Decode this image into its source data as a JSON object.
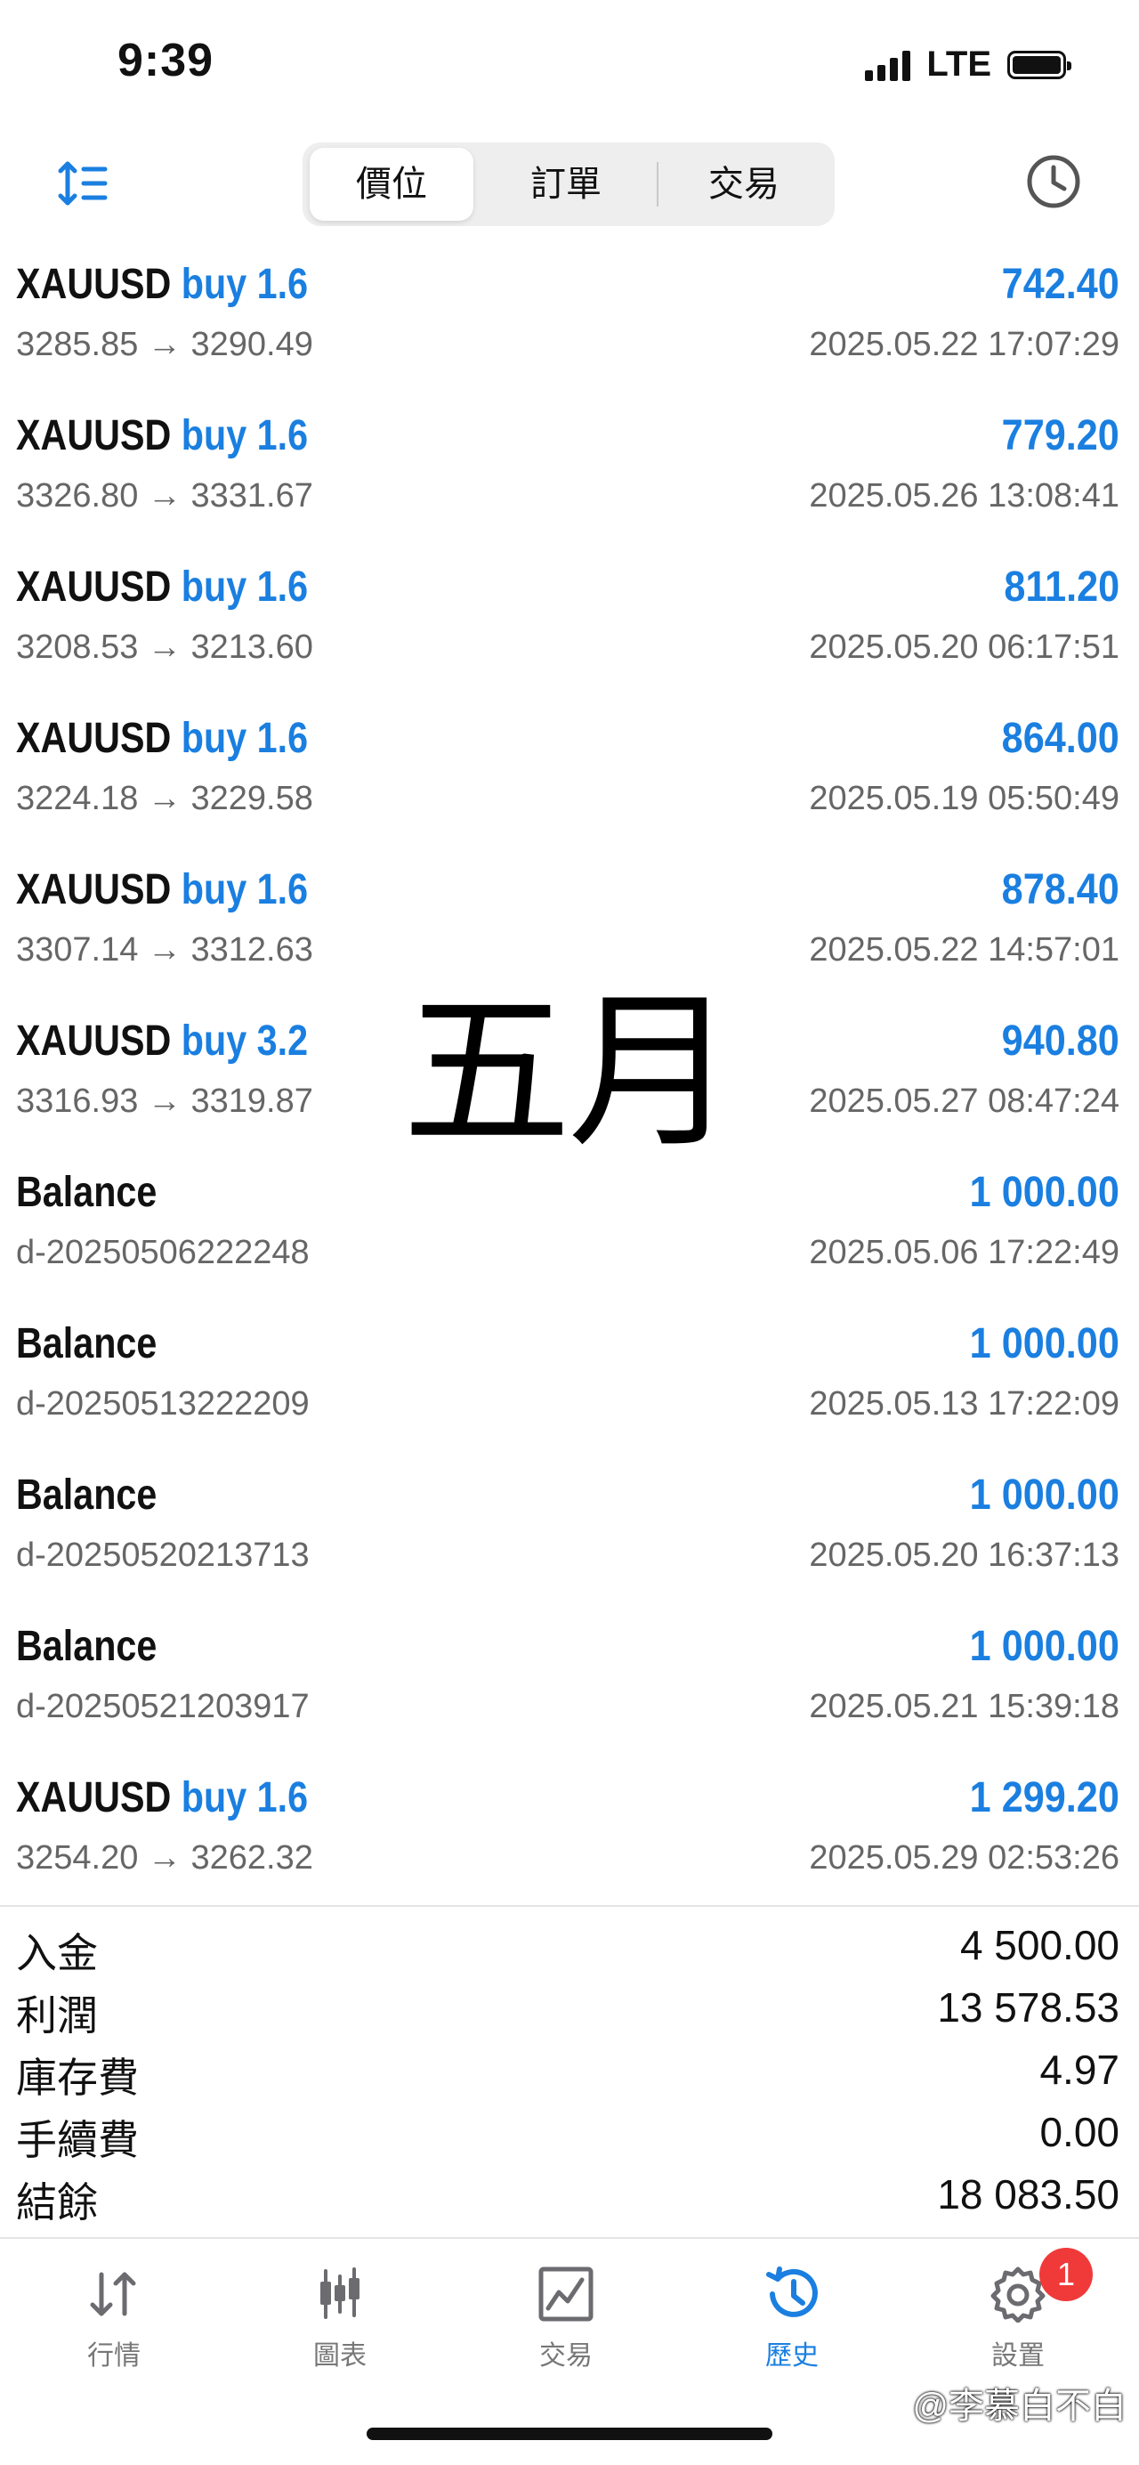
{
  "status_bar": {
    "time": "9:39",
    "network": "LTE"
  },
  "toolbar": {
    "sort_icon": "sort-icon",
    "history_icon": "clock-icon",
    "segments": [
      "價位",
      "訂單",
      "交易"
    ],
    "active_segment": "價位"
  },
  "deals": [
    {
      "symbol": "XAUUSD",
      "side": "buy 1.6",
      "profit": "742.40",
      "detail": "3285.85 → 3290.49",
      "time": "2025.05.22 17:07:29"
    },
    {
      "symbol": "XAUUSD",
      "side": "buy 1.6",
      "profit": "779.20",
      "detail": "3326.80 → 3331.67",
      "time": "2025.05.26 13:08:41"
    },
    {
      "symbol": "XAUUSD",
      "side": "buy 1.6",
      "profit": "811.20",
      "detail": "3208.53 → 3213.60",
      "time": "2025.05.20 06:17:51"
    },
    {
      "symbol": "XAUUSD",
      "side": "buy 1.6",
      "profit": "864.00",
      "detail": "3224.18 → 3229.58",
      "time": "2025.05.19 05:50:49"
    },
    {
      "symbol": "XAUUSD",
      "side": "buy 1.6",
      "profit": "878.40",
      "detail": "3307.14 → 3312.63",
      "time": "2025.05.22 14:57:01"
    },
    {
      "symbol": "XAUUSD",
      "side": "buy 3.2",
      "profit": "940.80",
      "detail": "3316.93 → 3319.87",
      "time": "2025.05.27 08:47:24"
    },
    {
      "symbol": "Balance",
      "side": "",
      "profit": "1 000.00",
      "detail": "d-20250506222248",
      "time": "2025.05.06 17:22:49"
    },
    {
      "symbol": "Balance",
      "side": "",
      "profit": "1 000.00",
      "detail": "d-20250513222209",
      "time": "2025.05.13 17:22:09"
    },
    {
      "symbol": "Balance",
      "side": "",
      "profit": "1 000.00",
      "detail": "d-20250520213713",
      "time": "2025.05.20 16:37:13"
    },
    {
      "symbol": "Balance",
      "side": "",
      "profit": "1 000.00",
      "detail": "d-20250521203917",
      "time": "2025.05.21 15:39:18"
    },
    {
      "symbol": "XAUUSD",
      "side": "buy 1.6",
      "profit": "1 299.20",
      "detail": "3254.20 → 3262.32",
      "time": "2025.05.29 02:53:26"
    }
  ],
  "overlay_text": "五月",
  "summary": [
    {
      "label": "入金",
      "value": "4 500.00"
    },
    {
      "label": "利潤",
      "value": "13 578.53"
    },
    {
      "label": "庫存費",
      "value": "4.97"
    },
    {
      "label": "手續費",
      "value": "0.00"
    },
    {
      "label": "結餘",
      "value": "18 083.50"
    }
  ],
  "tabbar": {
    "tabs": [
      {
        "label": "行情",
        "icon": "quotes-arrows-icon"
      },
      {
        "label": "圖表",
        "icon": "candlestick-chart-icon"
      },
      {
        "label": "交易",
        "icon": "trade-chart-icon"
      },
      {
        "label": "歷史",
        "icon": "history-clock-icon"
      },
      {
        "label": "設置",
        "icon": "gear-icon"
      }
    ],
    "active": "歷史",
    "settings_badge": "1"
  },
  "credit": "@李慕白不白",
  "colors": {
    "accent": "#1a7fe0",
    "badge": "#f03a3a",
    "muted": "#666666"
  }
}
